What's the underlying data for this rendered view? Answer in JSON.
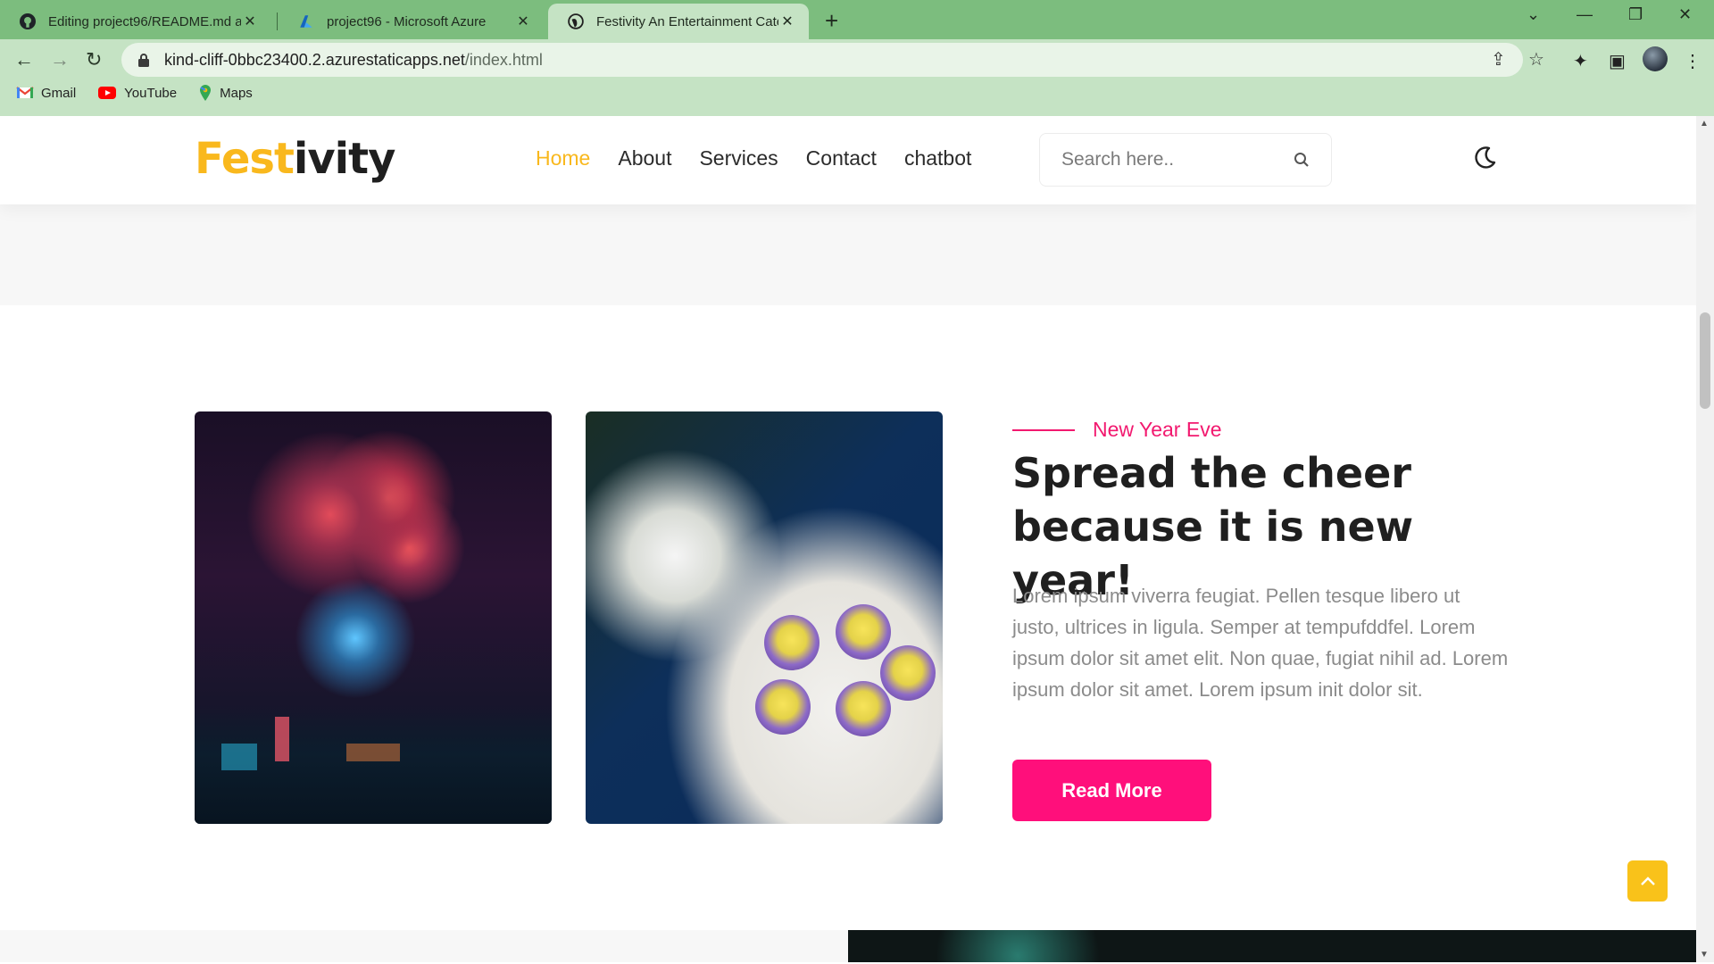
{
  "browser": {
    "tabs": [
      {
        "title": "Editing project96/README.md at",
        "icon": "github-icon"
      },
      {
        "title": "project96 - Microsoft Azure",
        "icon": "azure-icon"
      },
      {
        "title": "Festivity An Entertainment Categ",
        "icon": "globe-icon",
        "active": true
      }
    ],
    "url_host": "kind-cliff-0bbc23400.2.azurestaticapps.net",
    "url_path": "/index.html",
    "bookmarks": [
      {
        "label": "Gmail",
        "icon": "gmail-icon"
      },
      {
        "label": "YouTube",
        "icon": "youtube-icon"
      },
      {
        "label": "Maps",
        "icon": "maps-icon"
      }
    ],
    "colors": {
      "frame": "#7cbd7e",
      "toolbar": "#c5e3c4"
    }
  },
  "site": {
    "logo_part1": "Fest",
    "logo_part2": "ivity",
    "nav": [
      "Home",
      "About",
      "Services",
      "Contact",
      "chatbot"
    ],
    "active_nav": "Home",
    "search_placeholder": "Search here..",
    "icons": {
      "search": "search-icon",
      "theme": "moon-icon",
      "back_to_top": "chevron-up-icon"
    }
  },
  "feature": {
    "eyebrow": "New Year Eve",
    "heading": "Spread the cheer because it is new year!",
    "paragraph": "Lorem ipsum viverra feugiat. Pellen tesque libero ut justo, ultrices in ligula. Semper at tempufddfel. Lorem ipsum dolor sit amet elit. Non quae, fugiat nihil ad. Lorem ipsum dolor sit amet. Lorem ipsum init dolor sit.",
    "button": "Read More",
    "images": [
      "fireworks over city skyline at night",
      "cupcakes on white plate with white flowers"
    ]
  },
  "colors": {
    "accent_yellow": "#f9b81d",
    "accent_pink": "#ff0f7b",
    "heading": "#1f1f1f",
    "body_text": "#8b8b8b"
  }
}
